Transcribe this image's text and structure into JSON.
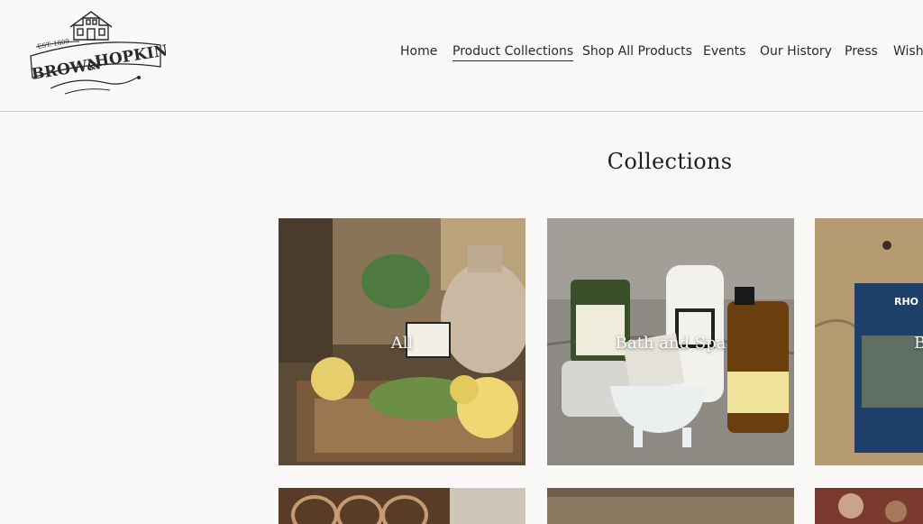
{
  "brand": {
    "name_left": "BROWN",
    "name_amp": "&",
    "name_right": "HOPKINS",
    "est": "EST. 1809"
  },
  "nav": [
    {
      "label": "Home"
    },
    {
      "label": "Product Collections",
      "active": true
    },
    {
      "label": "Shop All Products"
    },
    {
      "label": "Events"
    },
    {
      "label": "Our History"
    },
    {
      "label": "Press"
    },
    {
      "label": "Wish"
    }
  ],
  "page": {
    "heading": "Collections"
  },
  "collections": [
    {
      "label": "All"
    },
    {
      "label": "Bath and Spa"
    },
    {
      "label": "B"
    }
  ],
  "colors": {
    "text": "#222222",
    "divider": "#cfcfcf",
    "background": "#faf9f7"
  }
}
